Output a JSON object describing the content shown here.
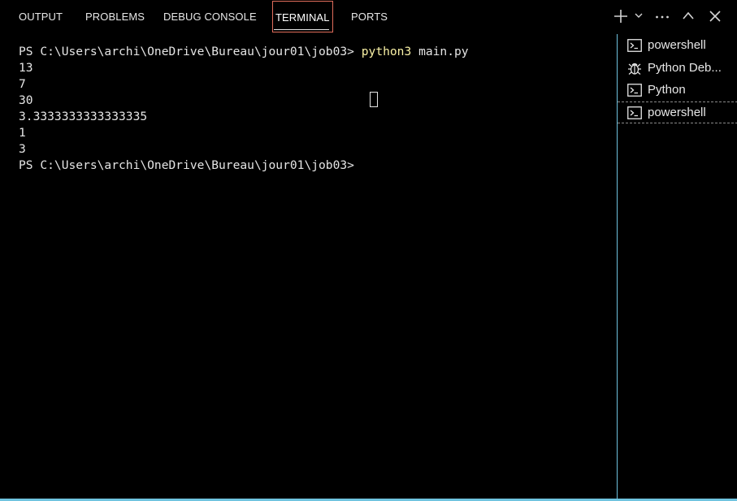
{
  "tabs": [
    {
      "label": "OUTPUT"
    },
    {
      "label": "PROBLEMS"
    },
    {
      "label": "DEBUG CONSOLE"
    },
    {
      "label": "TERMINAL",
      "active": true
    },
    {
      "label": "PORTS"
    }
  ],
  "terminal": {
    "prompt": "PS C:\\Users\\archi\\OneDrive\\Bureau\\jour01\\job03>",
    "command_exe": "python3",
    "command_args": "main.py",
    "output": [
      "13",
      "7",
      "30",
      "3.3333333333333335",
      "1",
      "3"
    ],
    "final_prompt": "PS C:\\Users\\archi\\OneDrive\\Bureau\\jour01\\job03>"
  },
  "terminals_list": [
    {
      "label": "powershell",
      "icon": "terminal-icon"
    },
    {
      "label": "Python Deb...",
      "icon": "debug-icon"
    },
    {
      "label": "Python",
      "icon": "terminal-icon"
    },
    {
      "label": "powershell",
      "icon": "terminal-icon",
      "selected": true
    }
  ],
  "colors": {
    "background": "#000000",
    "text": "#e5e5e5",
    "command": "#f9f1a5",
    "active_tab_border": "#e06c5b",
    "focus_border": "#6fc3df"
  }
}
